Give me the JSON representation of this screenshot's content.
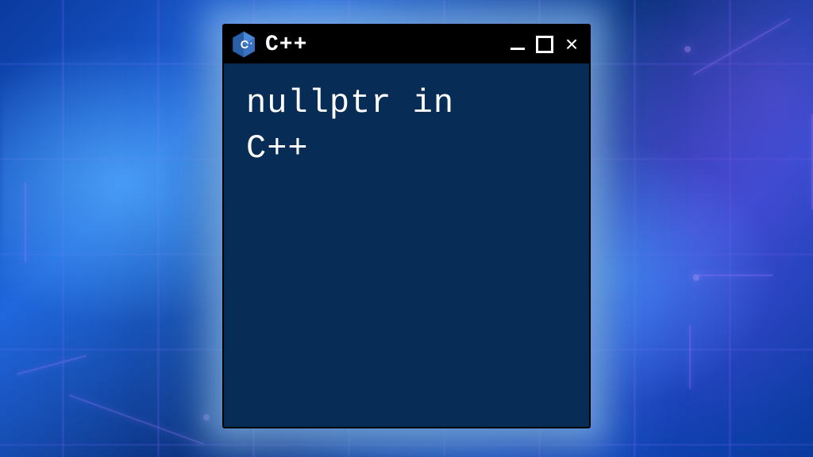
{
  "window": {
    "title": "C++",
    "icon_name": "cpp-hexagon-logo",
    "controls": {
      "minimize": "−",
      "maximize": "□",
      "close": "×"
    }
  },
  "terminal": {
    "content_line1": "nullptr in",
    "content_line2": "C++"
  },
  "colors": {
    "titlebar_bg": "#000000",
    "terminal_bg": "#072d57",
    "text": "#ffffff",
    "accent_icon": "#2a5fa8"
  }
}
